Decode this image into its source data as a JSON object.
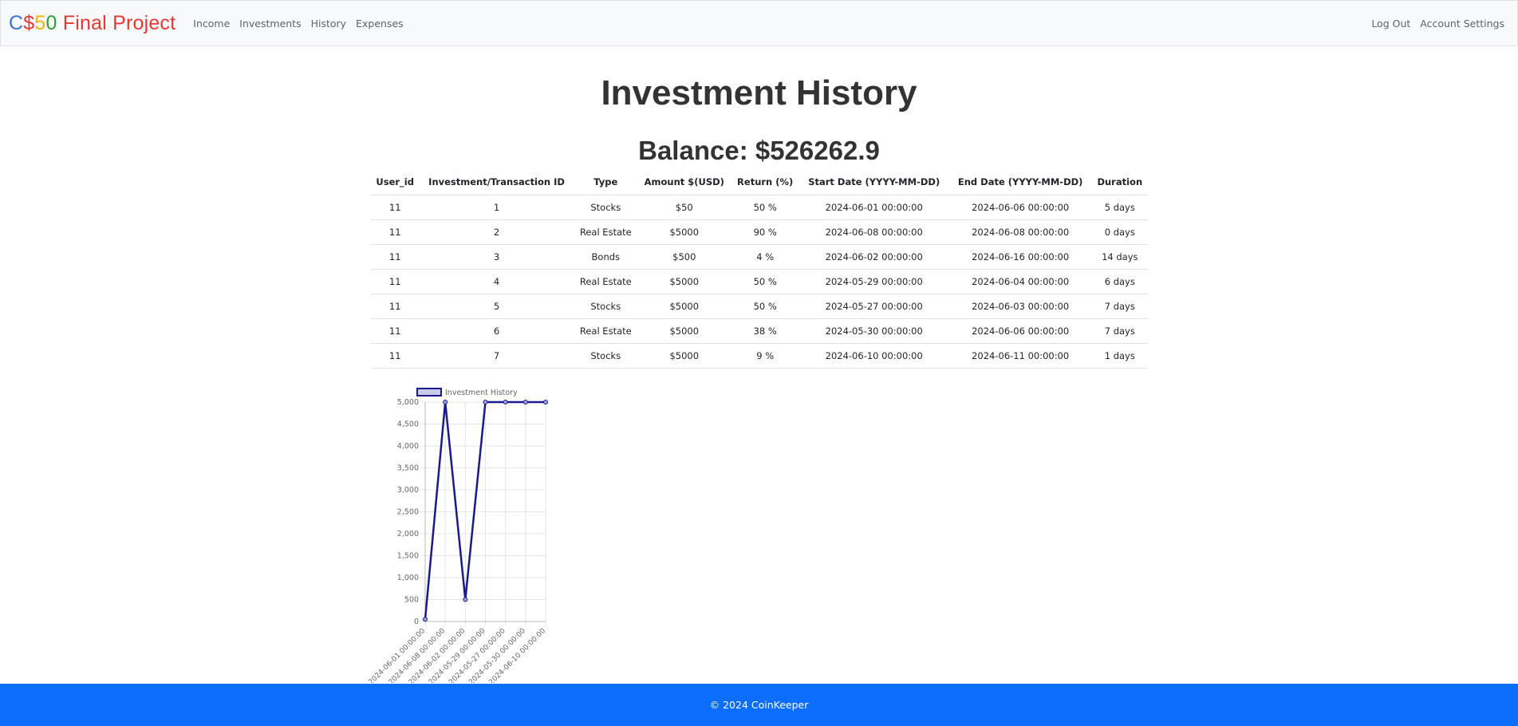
{
  "nav": {
    "brand": [
      {
        "text": "C",
        "color": "#3b74d6"
      },
      {
        "text": "$",
        "color": "#e53935"
      },
      {
        "text": "5",
        "color": "#f0b400"
      },
      {
        "text": "0",
        "color": "#2e9e3a"
      },
      {
        "text": " Final Project",
        "color": "#e53935"
      }
    ],
    "links": [
      "Income",
      "Investments",
      "History",
      "Expenses"
    ],
    "right_links": [
      "Log Out",
      "Account Settings"
    ]
  },
  "page": {
    "title": "Investment History",
    "balance": "Balance: $526262.9"
  },
  "table": {
    "headers": [
      "User_id",
      "Investment/Transaction ID",
      "Type",
      "Amount $(USD)",
      "Return (%)",
      "Start Date (YYYY-MM-DD)",
      "End Date (YYYY-MM-DD)",
      "Duration"
    ],
    "rows": [
      [
        "11",
        "1",
        "Stocks",
        "$50",
        "50 %",
        "2024-06-01 00:00:00",
        "2024-06-06 00:00:00",
        "5 days"
      ],
      [
        "11",
        "2",
        "Real Estate",
        "$5000",
        "90 %",
        "2024-06-08 00:00:00",
        "2024-06-08 00:00:00",
        "0 days"
      ],
      [
        "11",
        "3",
        "Bonds",
        "$500",
        "4 %",
        "2024-06-02 00:00:00",
        "2024-06-16 00:00:00",
        "14 days"
      ],
      [
        "11",
        "4",
        "Real Estate",
        "$5000",
        "50 %",
        "2024-05-29 00:00:00",
        "2024-06-04 00:00:00",
        "6 days"
      ],
      [
        "11",
        "5",
        "Stocks",
        "$5000",
        "50 %",
        "2024-05-27 00:00:00",
        "2024-06-03 00:00:00",
        "7 days"
      ],
      [
        "11",
        "6",
        "Real Estate",
        "$5000",
        "38 %",
        "2024-05-30 00:00:00",
        "2024-06-06 00:00:00",
        "7 days"
      ],
      [
        "11",
        "7",
        "Stocks",
        "$5000",
        "9 %",
        "2024-06-10 00:00:00",
        "2024-06-11 00:00:00",
        "1 days"
      ]
    ]
  },
  "chart_data": {
    "type": "line",
    "x": [
      "2024-06-01 00:00:00",
      "2024-06-08 00:00:00",
      "2024-06-02 00:00:00",
      "2024-05-29 00:00:00",
      "2024-05-27 00:00:00",
      "2024-05-30 00:00:00",
      "2024-06-10 00:00:00"
    ],
    "series": [
      {
        "name": "Investment History",
        "values": [
          50,
          5000,
          500,
          5000,
          5000,
          5000,
          5000
        ],
        "color": "#1a1a8c"
      }
    ],
    "ylim": [
      0,
      5000
    ],
    "yticks": [
      0,
      500,
      1000,
      1500,
      2000,
      2500,
      3000,
      3500,
      4000,
      4500,
      5000
    ],
    "ytick_labels": [
      "0",
      "500",
      "1,000",
      "1,500",
      "2,000",
      "2,500",
      "3,000",
      "3,500",
      "4,000",
      "4,500",
      "5,000"
    ],
    "grid": true,
    "legend": "top"
  },
  "footer": {
    "text": "© 2024 CoinKeeper",
    "color": "#0d6efd"
  }
}
